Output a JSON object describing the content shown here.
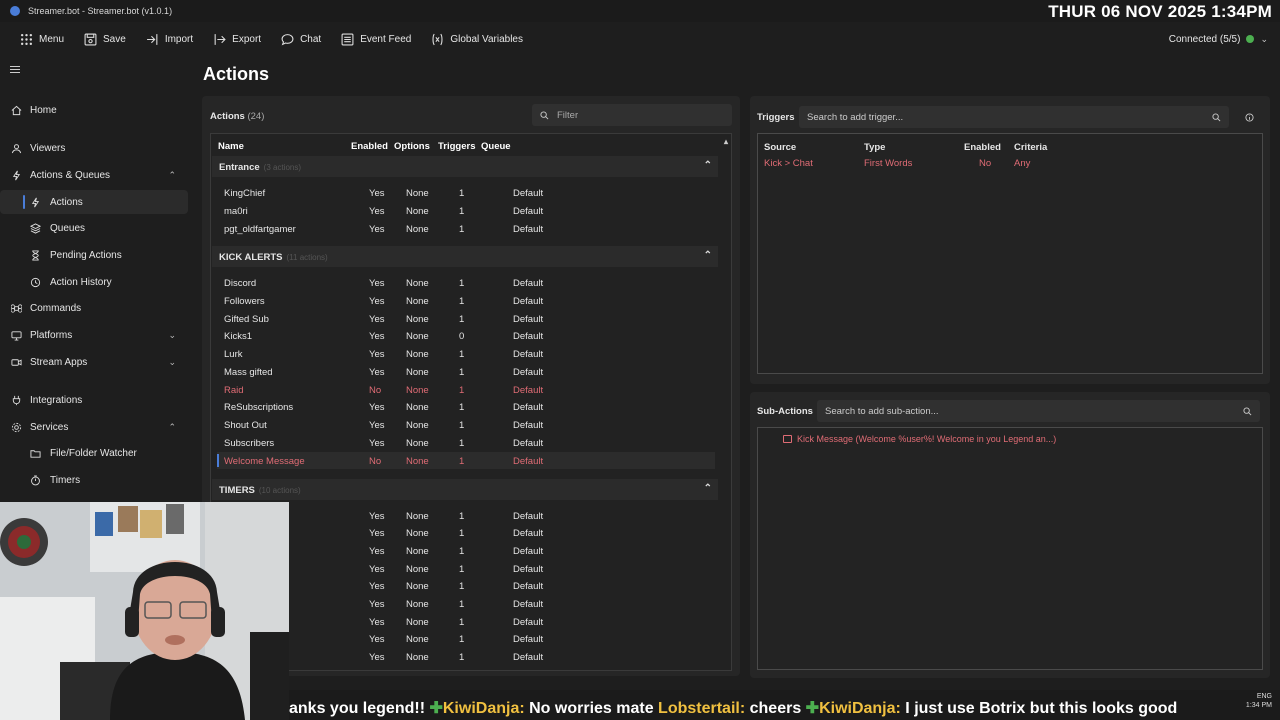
{
  "window": {
    "title": "Streamer.bot - Streamer.bot (v1.0.1)"
  },
  "clock": "THUR 06 NOV 2025 1:34PM",
  "toolbar": {
    "menu": "Menu",
    "save": "Save",
    "import": "Import",
    "export": "Export",
    "chat": "Chat",
    "event_feed": "Event Feed",
    "global_variables": "Global Variables"
  },
  "connection": {
    "status": "Connected (5/5)",
    "color": "#4caf50"
  },
  "sidebar": {
    "home": "Home",
    "viewers": "Viewers",
    "actions_queues": "Actions & Queues",
    "actions": "Actions",
    "queues": "Queues",
    "pending_actions": "Pending Actions",
    "action_history": "Action History",
    "commands": "Commands",
    "platforms": "Platforms",
    "stream_apps": "Stream Apps",
    "integrations": "Integrations",
    "services": "Services",
    "file_watcher": "File/Folder Watcher",
    "timers": "Timers"
  },
  "page_title": "Actions",
  "actions_panel": {
    "title": "Actions",
    "count": "(24)",
    "filter_placeholder": "Filter",
    "columns": {
      "name": "Name",
      "enabled": "Enabled",
      "options": "Options",
      "triggers": "Triggers",
      "queue": "Queue"
    },
    "groups": [
      {
        "name": "Entrance",
        "count": "(3 actions)",
        "rows": [
          {
            "name": "KingChief",
            "enabled": "Yes",
            "options": "None",
            "triggers": "1",
            "queue": "Default"
          },
          {
            "name": "ma0ri",
            "enabled": "Yes",
            "options": "None",
            "triggers": "1",
            "queue": "Default"
          },
          {
            "name": "pgt_oldfartgamer",
            "enabled": "Yes",
            "options": "None",
            "triggers": "1",
            "queue": "Default"
          }
        ]
      },
      {
        "name": "KICK ALERTS",
        "count": "(11 actions)",
        "rows": [
          {
            "name": "Discord",
            "enabled": "Yes",
            "options": "None",
            "triggers": "1",
            "queue": "Default"
          },
          {
            "name": "Followers",
            "enabled": "Yes",
            "options": "None",
            "triggers": "1",
            "queue": "Default"
          },
          {
            "name": "Gifted Sub",
            "enabled": "Yes",
            "options": "None",
            "triggers": "1",
            "queue": "Default"
          },
          {
            "name": "Kicks1",
            "enabled": "Yes",
            "options": "None",
            "triggers": "0",
            "queue": "Default"
          },
          {
            "name": "Lurk",
            "enabled": "Yes",
            "options": "None",
            "triggers": "1",
            "queue": "Default"
          },
          {
            "name": "Mass gifted",
            "enabled": "Yes",
            "options": "None",
            "triggers": "1",
            "queue": "Default"
          },
          {
            "name": "Raid",
            "enabled": "No",
            "options": "None",
            "triggers": "1",
            "queue": "Default"
          },
          {
            "name": "ReSubscriptions",
            "enabled": "Yes",
            "options": "None",
            "triggers": "1",
            "queue": "Default"
          },
          {
            "name": "Shout Out",
            "enabled": "Yes",
            "options": "None",
            "triggers": "1",
            "queue": "Default"
          },
          {
            "name": "Subscribers",
            "enabled": "Yes",
            "options": "None",
            "triggers": "1",
            "queue": "Default"
          },
          {
            "name": "Welcome Message",
            "enabled": "No",
            "options": "None",
            "triggers": "1",
            "queue": "Default"
          }
        ]
      },
      {
        "name": "TIMERS",
        "count": "(10 actions)",
        "rows": [
          {
            "name": "",
            "enabled": "Yes",
            "options": "None",
            "triggers": "1",
            "queue": "Default"
          },
          {
            "name": "",
            "enabled": "Yes",
            "options": "None",
            "triggers": "1",
            "queue": "Default"
          },
          {
            "name": "",
            "enabled": "Yes",
            "options": "None",
            "triggers": "1",
            "queue": "Default"
          },
          {
            "name": "",
            "enabled": "Yes",
            "options": "None",
            "triggers": "1",
            "queue": "Default"
          },
          {
            "name": "",
            "enabled": "Yes",
            "options": "None",
            "triggers": "1",
            "queue": "Default"
          },
          {
            "name": "",
            "enabled": "Yes",
            "options": "None",
            "triggers": "1",
            "queue": "Default"
          },
          {
            "name": "",
            "enabled": "Yes",
            "options": "None",
            "triggers": "1",
            "queue": "Default"
          },
          {
            "name": "",
            "enabled": "Yes",
            "options": "None",
            "triggers": "1",
            "queue": "Default"
          },
          {
            "name": "",
            "enabled": "Yes",
            "options": "None",
            "triggers": "1",
            "queue": "Default"
          }
        ]
      }
    ]
  },
  "triggers_panel": {
    "title": "Triggers",
    "search_placeholder": "Search to add trigger...",
    "columns": {
      "source": "Source",
      "type": "Type",
      "enabled": "Enabled",
      "criteria": "Criteria"
    },
    "rows": [
      {
        "source": "Kick > Chat",
        "type": "First Words",
        "enabled": "No",
        "criteria": "Any"
      }
    ]
  },
  "subactions_panel": {
    "title": "Sub-Actions",
    "search_placeholder": "Search to add sub-action...",
    "items": [
      "Kick Message (Welcome %user%! Welcome in you Legend an...)"
    ]
  },
  "ticker": {
    "segments": [
      {
        "kind": "text",
        "text": "anks you legend!! "
      },
      {
        "kind": "user",
        "text": "KiwiDanja:"
      },
      {
        "kind": "text",
        "text": " No worries mate "
      },
      {
        "kind": "user",
        "text": "Lobstertail:"
      },
      {
        "kind": "text",
        "text": " cheers "
      },
      {
        "kind": "user",
        "text": "KiwiDanja:"
      },
      {
        "kind": "text",
        "text": " I just use Botrix but this looks good"
      }
    ]
  },
  "tray": {
    "lang": "ENG",
    "time": "1:34 PM"
  },
  "colors": {
    "accent": "#4a7dd8",
    "disabled": "#e06c75",
    "connected": "#4caf50"
  }
}
